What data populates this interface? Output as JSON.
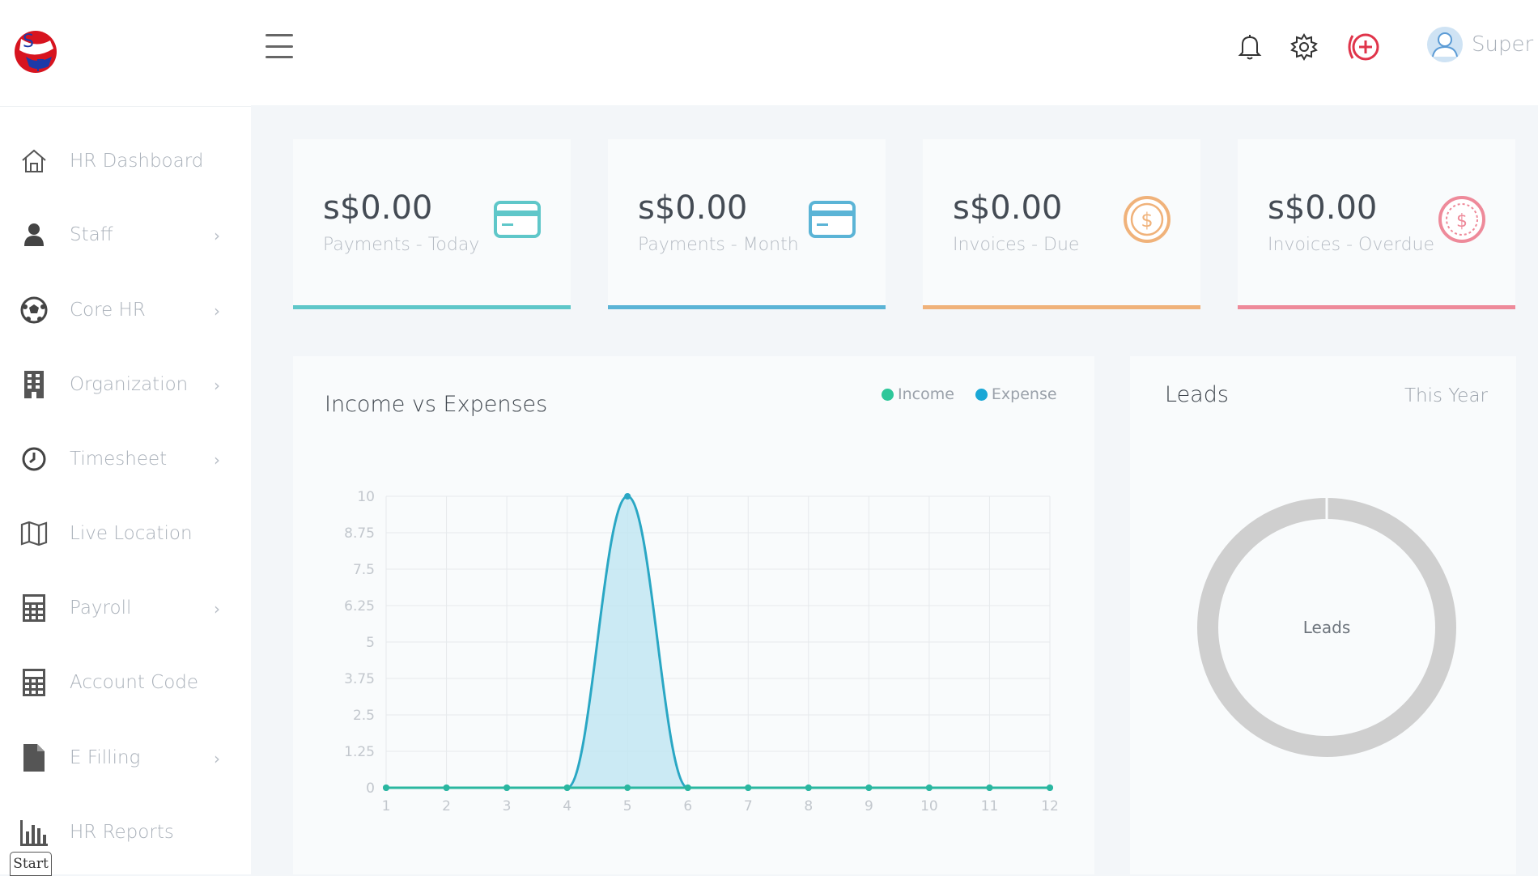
{
  "sidebar": {
    "items": [
      {
        "label": "HR Dashboard",
        "icon": "home-icon",
        "chevron": false
      },
      {
        "label": "Staff",
        "icon": "user-icon",
        "chevron": true
      },
      {
        "label": "Core HR",
        "icon": "soccer-ball-icon",
        "chevron": true
      },
      {
        "label": "Organization",
        "icon": "building-icon",
        "chevron": true
      },
      {
        "label": "Timesheet",
        "icon": "clock-icon",
        "chevron": true
      },
      {
        "label": "Live Location",
        "icon": "map-icon",
        "chevron": false
      },
      {
        "label": "Payroll",
        "icon": "calculator-icon",
        "chevron": true
      },
      {
        "label": "Account Code",
        "icon": "calculator-icon",
        "chevron": false
      },
      {
        "label": "E Filling",
        "icon": "file-icon",
        "chevron": true
      },
      {
        "label": "HR Reports",
        "icon": "bar-chart-icon",
        "chevron": false
      }
    ],
    "chevron_glyph": "›"
  },
  "header": {
    "user_name": "Super",
    "icons": [
      "bell-icon",
      "gear-icon",
      "add-circle-icon"
    ]
  },
  "taskbar": {
    "start_label": "Start"
  },
  "cards": [
    {
      "amount": "s$0.00",
      "label": "Payments - Today",
      "icon": "credit-card-icon",
      "color": "#5fc7c9"
    },
    {
      "amount": "s$0.00",
      "label": "Payments - Month",
      "icon": "credit-card-icon",
      "color": "#5bb4d6"
    },
    {
      "amount": "s$0.00",
      "label": "Invoices - Due",
      "icon": "dollar-coin-icon",
      "color": "#f0b27a"
    },
    {
      "amount": "s$0.00",
      "label": "Invoices - Overdue",
      "icon": "dollar-coin-icon",
      "color": "#ee8a9a"
    }
  ],
  "income_chart": {
    "title": "Income vs Expenses",
    "legend": [
      {
        "name": "Income",
        "color": "#2ec79a"
      },
      {
        "name": "Expense",
        "color": "#1aa7d6"
      }
    ]
  },
  "leads_panel": {
    "title": "Leads",
    "period": "This Year",
    "center_label": "Leads"
  },
  "chart_data": [
    {
      "type": "line",
      "title": "Income vs Expenses",
      "x": [
        1,
        2,
        3,
        4,
        5,
        6,
        7,
        8,
        9,
        10,
        11,
        12
      ],
      "series": [
        {
          "name": "Income",
          "values": [
            0,
            0,
            0,
            0,
            0,
            0,
            0,
            0,
            0,
            0,
            0,
            0
          ],
          "color": "#2ec79a"
        },
        {
          "name": "Expense",
          "values": [
            0,
            0,
            0,
            0,
            10,
            0,
            0,
            0,
            0,
            0,
            0,
            0
          ],
          "color": "#1aa7d6"
        }
      ],
      "yticks": [
        "0",
        "1.25",
        "2.5",
        "3.75",
        "5",
        "6.25",
        "7.5",
        "8.75",
        "10"
      ],
      "xticks": [
        "1",
        "2",
        "3",
        "4",
        "5",
        "6",
        "7",
        "8",
        "9",
        "10",
        "11",
        "12"
      ],
      "ylim": [
        0,
        10
      ],
      "xlim": [
        1,
        12
      ],
      "grid": true,
      "legend_position": "top-right"
    },
    {
      "type": "pie",
      "title": "Leads",
      "categories": [
        ""
      ],
      "values": [
        1
      ],
      "center_label": "Leads",
      "color": "#cfcfcf"
    }
  ]
}
